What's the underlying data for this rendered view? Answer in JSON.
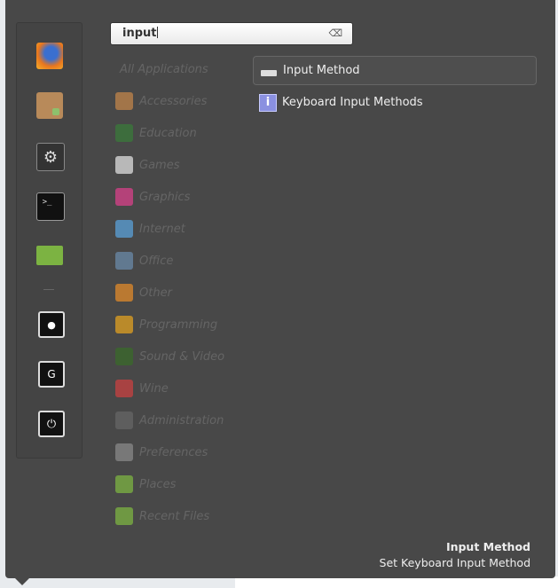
{
  "search": {
    "value": "input",
    "clear_icon": "clear-text-icon"
  },
  "favorites": [
    {
      "name": "firefox",
      "icon": "firefox-icon",
      "color": "#e8761e"
    },
    {
      "name": "software-manager",
      "icon": "package-icon",
      "color": "#b88a5a"
    },
    {
      "name": "system-settings",
      "icon": "settings-icon",
      "color": "#555555"
    },
    {
      "name": "terminal",
      "icon": "terminal-icon",
      "color": "#222222"
    },
    {
      "name": "files",
      "icon": "folder-icon",
      "color": "#7cb342"
    }
  ],
  "session": [
    {
      "name": "lock-screen",
      "icon": "lock-icon"
    },
    {
      "name": "logout",
      "icon": "logout-icon"
    },
    {
      "name": "shutdown",
      "icon": "power-icon"
    }
  ],
  "categories": [
    {
      "label": "All Applications",
      "color": ""
    },
    {
      "label": "Accessories",
      "color": "#c0844a"
    },
    {
      "label": "Education",
      "color": "#3a7a3a"
    },
    {
      "label": "Games",
      "color": "#dddddd"
    },
    {
      "label": "Graphics",
      "color": "#d8408a"
    },
    {
      "label": "Internet",
      "color": "#5aa0d8"
    },
    {
      "label": "Office",
      "color": "#6a8aa8"
    },
    {
      "label": "Other",
      "color": "#e08a2a"
    },
    {
      "label": "Programming",
      "color": "#e0a020"
    },
    {
      "label": "Sound & Video",
      "color": "#3a6a2a"
    },
    {
      "label": "Wine",
      "color": "#c84040"
    },
    {
      "label": "Administration",
      "color": "#666666"
    },
    {
      "label": "Preferences",
      "color": "#888888"
    },
    {
      "label": "Places",
      "color": "#7cb342"
    },
    {
      "label": "Recent Files",
      "color": "#7cb342"
    }
  ],
  "results": [
    {
      "label": "Input Method",
      "icon": "keyboard-icon"
    },
    {
      "label": "Keyboard Input Methods",
      "icon": "info-icon"
    }
  ],
  "selected_info": {
    "title": "Input Method",
    "description": "Set Keyboard Input Method"
  }
}
